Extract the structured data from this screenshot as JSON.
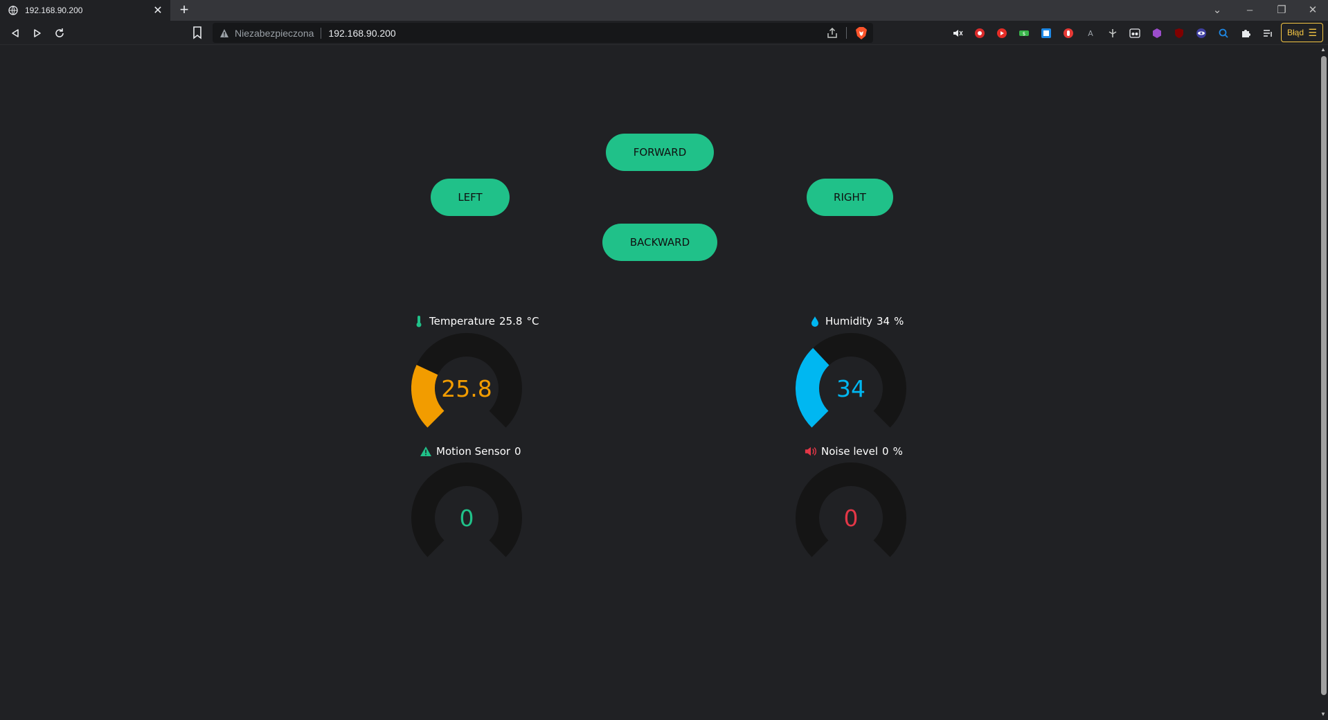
{
  "browser": {
    "tab_title": "192.168.90.200",
    "security_text": "Niezabezpieczona",
    "url": "192.168.90.200",
    "error_badge": "Błąd"
  },
  "controls": {
    "forward": "FORWARD",
    "left": "LEFT",
    "right": "RIGHT",
    "backward": "BACKWARD"
  },
  "sensors": {
    "temperature": {
      "label": "Temperature",
      "value": "25.8",
      "unit": "°C",
      "gauge_value": "25.8",
      "fraction": 0.26,
      "color": "#f29c00",
      "icon": "thermometer-icon"
    },
    "humidity": {
      "label": "Humidity",
      "value": "34",
      "unit": "%",
      "gauge_value": "34",
      "fraction": 0.34,
      "color": "#00b7f1",
      "icon": "water-drop-icon"
    },
    "motion": {
      "label": "Motion Sensor",
      "value": "0",
      "gauge_value": "0",
      "fraction": 0,
      "color": "#20c189",
      "icon": "warning-triangle-icon"
    },
    "noise": {
      "label": "Noise level",
      "value": "0",
      "unit": "%",
      "gauge_value": "0",
      "fraction": 0,
      "color": "#e33747",
      "icon": "speaker-icon"
    }
  },
  "colors": {
    "button": "#20c189",
    "background": "#202124",
    "gauge_track": "#151515"
  }
}
